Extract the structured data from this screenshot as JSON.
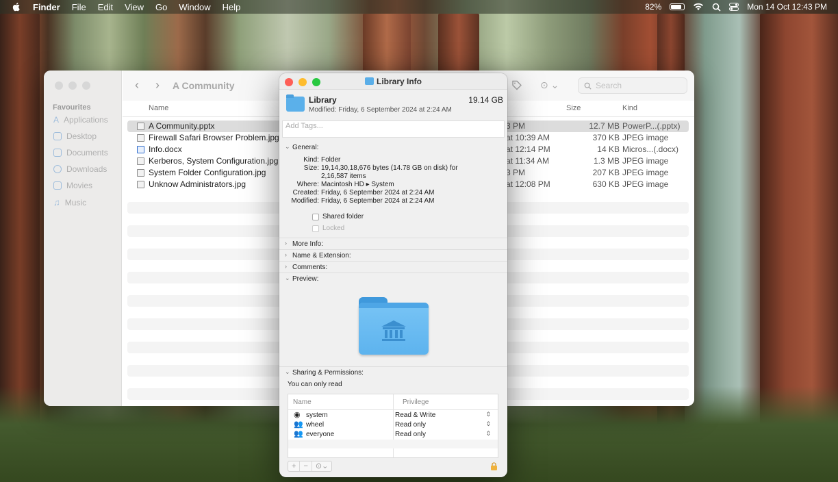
{
  "menubar": {
    "app": "Finder",
    "menus": [
      "File",
      "Edit",
      "View",
      "Go",
      "Window",
      "Help"
    ],
    "battery": "82%",
    "datetime": "Mon 14 Oct  12:43 PM"
  },
  "finder": {
    "title": "A Community",
    "search_placeholder": "Search",
    "sidebar_heading": "Favourites",
    "sidebar": [
      "Applications",
      "Desktop",
      "Documents",
      "Downloads",
      "Movies",
      "Music"
    ],
    "columns": {
      "name": "Name",
      "size": "Size",
      "kind": "Kind"
    },
    "files": [
      {
        "name": "A Community.pptx",
        "date": "3 PM",
        "size": "12.7 MB",
        "kind": "PowerP...(.pptx)"
      },
      {
        "name": "Firewall Safari Browser Problem.jpg",
        "date": "at 10:39 AM",
        "size": "370 KB",
        "kind": "JPEG image"
      },
      {
        "name": "Info.docx",
        "date": "at 12:14 PM",
        "size": "14 KB",
        "kind": "Micros...(.docx)"
      },
      {
        "name": "Kerberos, System Configuration.jpg",
        "date": "at 11:34 AM",
        "size": "1.3 MB",
        "kind": "JPEG image"
      },
      {
        "name": "System Folder Configuration.jpg",
        "date": "3 PM",
        "size": "207 KB",
        "kind": "JPEG image"
      },
      {
        "name": "Unknow Administrators.jpg",
        "date": "at 12:08 PM",
        "size": "630 KB",
        "kind": "JPEG image"
      }
    ]
  },
  "info": {
    "window_title": "Library Info",
    "name": "Library",
    "modified_line": "Modified: Friday, 6 September 2024 at 2:24 AM",
    "size": "19.14 GB",
    "tags_placeholder": "Add Tags...",
    "general_label": "General:",
    "general": {
      "kind_k": "Kind:",
      "kind_v": "Folder",
      "size_k": "Size:",
      "size_v1": "19,14,30,18,676 bytes (14.78 GB on disk) for",
      "size_v2": "2,16,587 items",
      "where_k": "Where:",
      "where_v": "Macintosh HD ▸ System",
      "created_k": "Created:",
      "created_v": "Friday, 6 September 2024 at 2:24 AM",
      "modified_k": "Modified:",
      "modified_v": "Friday, 6 September 2024 at 2:24 AM"
    },
    "shared_folder": "Shared folder",
    "locked": "Locked",
    "sections": {
      "more_info": "More Info:",
      "name_ext": "Name & Extension:",
      "comments": "Comments:",
      "preview": "Preview:",
      "sharing": "Sharing & Permissions:"
    },
    "read_note": "You can only read",
    "perm_headers": {
      "name": "Name",
      "privilege": "Privilege"
    },
    "permissions": [
      {
        "name": "system",
        "privilege": "Read & Write"
      },
      {
        "name": "wheel",
        "privilege": "Read only"
      },
      {
        "name": "everyone",
        "privilege": "Read only"
      }
    ],
    "buttons": {
      "add": "+",
      "remove": "−",
      "action": "⊙⌄"
    }
  }
}
